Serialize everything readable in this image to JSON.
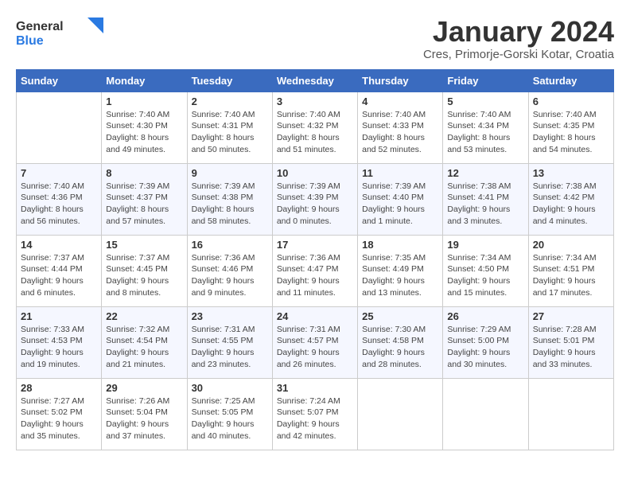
{
  "header": {
    "logo_general": "General",
    "logo_blue": "Blue",
    "month_title": "January 2024",
    "location": "Cres, Primorje-Gorski Kotar, Croatia"
  },
  "days_of_week": [
    "Sunday",
    "Monday",
    "Tuesday",
    "Wednesday",
    "Thursday",
    "Friday",
    "Saturday"
  ],
  "weeks": [
    [
      {
        "day": "",
        "sunrise": "",
        "sunset": "",
        "daylight": ""
      },
      {
        "day": "1",
        "sunrise": "Sunrise: 7:40 AM",
        "sunset": "Sunset: 4:30 PM",
        "daylight": "Daylight: 8 hours and 49 minutes."
      },
      {
        "day": "2",
        "sunrise": "Sunrise: 7:40 AM",
        "sunset": "Sunset: 4:31 PM",
        "daylight": "Daylight: 8 hours and 50 minutes."
      },
      {
        "day": "3",
        "sunrise": "Sunrise: 7:40 AM",
        "sunset": "Sunset: 4:32 PM",
        "daylight": "Daylight: 8 hours and 51 minutes."
      },
      {
        "day": "4",
        "sunrise": "Sunrise: 7:40 AM",
        "sunset": "Sunset: 4:33 PM",
        "daylight": "Daylight: 8 hours and 52 minutes."
      },
      {
        "day": "5",
        "sunrise": "Sunrise: 7:40 AM",
        "sunset": "Sunset: 4:34 PM",
        "daylight": "Daylight: 8 hours and 53 minutes."
      },
      {
        "day": "6",
        "sunrise": "Sunrise: 7:40 AM",
        "sunset": "Sunset: 4:35 PM",
        "daylight": "Daylight: 8 hours and 54 minutes."
      }
    ],
    [
      {
        "day": "7",
        "sunrise": "Sunrise: 7:40 AM",
        "sunset": "Sunset: 4:36 PM",
        "daylight": "Daylight: 8 hours and 56 minutes."
      },
      {
        "day": "8",
        "sunrise": "Sunrise: 7:39 AM",
        "sunset": "Sunset: 4:37 PM",
        "daylight": "Daylight: 8 hours and 57 minutes."
      },
      {
        "day": "9",
        "sunrise": "Sunrise: 7:39 AM",
        "sunset": "Sunset: 4:38 PM",
        "daylight": "Daylight: 8 hours and 58 minutes."
      },
      {
        "day": "10",
        "sunrise": "Sunrise: 7:39 AM",
        "sunset": "Sunset: 4:39 PM",
        "daylight": "Daylight: 9 hours and 0 minutes."
      },
      {
        "day": "11",
        "sunrise": "Sunrise: 7:39 AM",
        "sunset": "Sunset: 4:40 PM",
        "daylight": "Daylight: 9 hours and 1 minute."
      },
      {
        "day": "12",
        "sunrise": "Sunrise: 7:38 AM",
        "sunset": "Sunset: 4:41 PM",
        "daylight": "Daylight: 9 hours and 3 minutes."
      },
      {
        "day": "13",
        "sunrise": "Sunrise: 7:38 AM",
        "sunset": "Sunset: 4:42 PM",
        "daylight": "Daylight: 9 hours and 4 minutes."
      }
    ],
    [
      {
        "day": "14",
        "sunrise": "Sunrise: 7:37 AM",
        "sunset": "Sunset: 4:44 PM",
        "daylight": "Daylight: 9 hours and 6 minutes."
      },
      {
        "day": "15",
        "sunrise": "Sunrise: 7:37 AM",
        "sunset": "Sunset: 4:45 PM",
        "daylight": "Daylight: 9 hours and 8 minutes."
      },
      {
        "day": "16",
        "sunrise": "Sunrise: 7:36 AM",
        "sunset": "Sunset: 4:46 PM",
        "daylight": "Daylight: 9 hours and 9 minutes."
      },
      {
        "day": "17",
        "sunrise": "Sunrise: 7:36 AM",
        "sunset": "Sunset: 4:47 PM",
        "daylight": "Daylight: 9 hours and 11 minutes."
      },
      {
        "day": "18",
        "sunrise": "Sunrise: 7:35 AM",
        "sunset": "Sunset: 4:49 PM",
        "daylight": "Daylight: 9 hours and 13 minutes."
      },
      {
        "day": "19",
        "sunrise": "Sunrise: 7:34 AM",
        "sunset": "Sunset: 4:50 PM",
        "daylight": "Daylight: 9 hours and 15 minutes."
      },
      {
        "day": "20",
        "sunrise": "Sunrise: 7:34 AM",
        "sunset": "Sunset: 4:51 PM",
        "daylight": "Daylight: 9 hours and 17 minutes."
      }
    ],
    [
      {
        "day": "21",
        "sunrise": "Sunrise: 7:33 AM",
        "sunset": "Sunset: 4:53 PM",
        "daylight": "Daylight: 9 hours and 19 minutes."
      },
      {
        "day": "22",
        "sunrise": "Sunrise: 7:32 AM",
        "sunset": "Sunset: 4:54 PM",
        "daylight": "Daylight: 9 hours and 21 minutes."
      },
      {
        "day": "23",
        "sunrise": "Sunrise: 7:31 AM",
        "sunset": "Sunset: 4:55 PM",
        "daylight": "Daylight: 9 hours and 23 minutes."
      },
      {
        "day": "24",
        "sunrise": "Sunrise: 7:31 AM",
        "sunset": "Sunset: 4:57 PM",
        "daylight": "Daylight: 9 hours and 26 minutes."
      },
      {
        "day": "25",
        "sunrise": "Sunrise: 7:30 AM",
        "sunset": "Sunset: 4:58 PM",
        "daylight": "Daylight: 9 hours and 28 minutes."
      },
      {
        "day": "26",
        "sunrise": "Sunrise: 7:29 AM",
        "sunset": "Sunset: 5:00 PM",
        "daylight": "Daylight: 9 hours and 30 minutes."
      },
      {
        "day": "27",
        "sunrise": "Sunrise: 7:28 AM",
        "sunset": "Sunset: 5:01 PM",
        "daylight": "Daylight: 9 hours and 33 minutes."
      }
    ],
    [
      {
        "day": "28",
        "sunrise": "Sunrise: 7:27 AM",
        "sunset": "Sunset: 5:02 PM",
        "daylight": "Daylight: 9 hours and 35 minutes."
      },
      {
        "day": "29",
        "sunrise": "Sunrise: 7:26 AM",
        "sunset": "Sunset: 5:04 PM",
        "daylight": "Daylight: 9 hours and 37 minutes."
      },
      {
        "day": "30",
        "sunrise": "Sunrise: 7:25 AM",
        "sunset": "Sunset: 5:05 PM",
        "daylight": "Daylight: 9 hours and 40 minutes."
      },
      {
        "day": "31",
        "sunrise": "Sunrise: 7:24 AM",
        "sunset": "Sunset: 5:07 PM",
        "daylight": "Daylight: 9 hours and 42 minutes."
      },
      {
        "day": "",
        "sunrise": "",
        "sunset": "",
        "daylight": ""
      },
      {
        "day": "",
        "sunrise": "",
        "sunset": "",
        "daylight": ""
      },
      {
        "day": "",
        "sunrise": "",
        "sunset": "",
        "daylight": ""
      }
    ]
  ]
}
